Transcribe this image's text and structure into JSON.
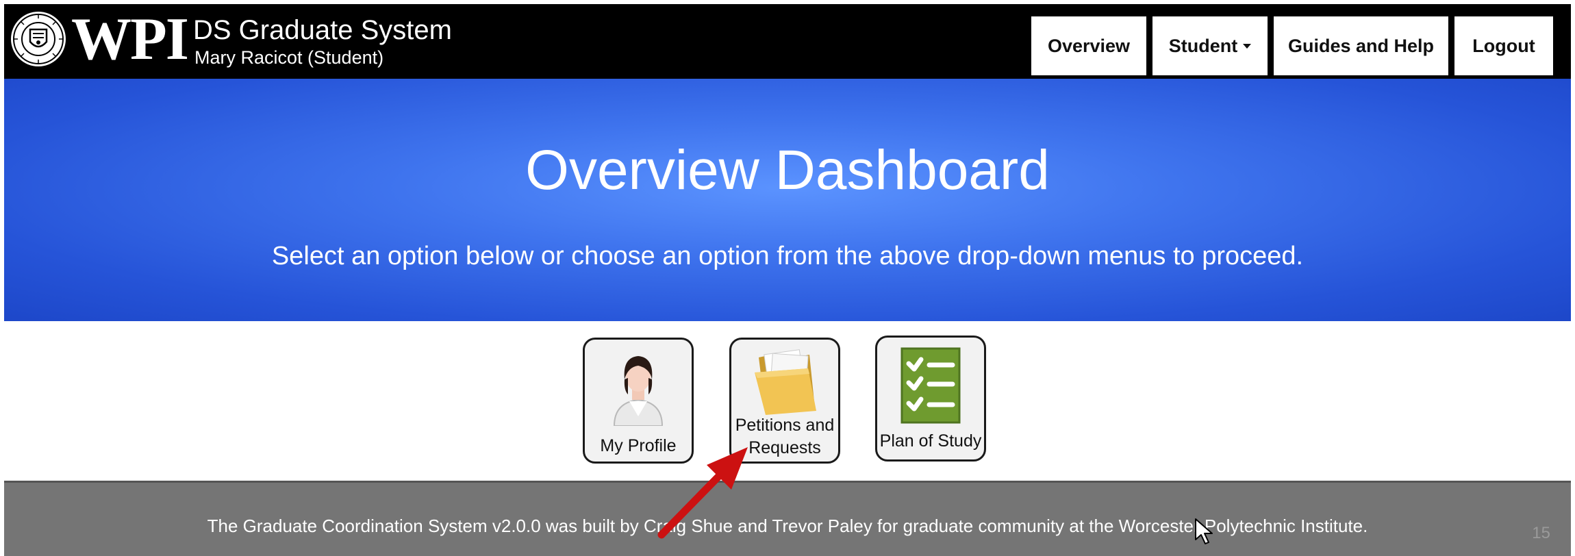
{
  "header": {
    "logo_text": "WPI",
    "system_title": "DS Graduate System",
    "user_line": "Mary Racicot (Student)",
    "nav": {
      "overview": "Overview",
      "student": "Student",
      "guides": "Guides and Help",
      "logout": "Logout"
    }
  },
  "hero": {
    "title": "Overview Dashboard",
    "subtitle": "Select an option below or choose an option from the above drop-down menus to proceed."
  },
  "tiles": [
    {
      "label": "My Profile",
      "icon": "user-avatar-icon"
    },
    {
      "label_line1": "Petitions and",
      "label_line2": "Requests",
      "icon": "folder-icon"
    },
    {
      "label": "Plan of Study",
      "icon": "checklist-icon"
    }
  ],
  "footer": {
    "text": "The Graduate Coordination System v2.0.0 was built by Craig Shue and Trevor Paley for graduate community at the Worcester Polytechnic Institute.",
    "slide_number": "15"
  },
  "colors": {
    "navbar": "#000000",
    "hero": "#2f63e0",
    "footer": "#757575",
    "annotation_arrow": "#cc1111"
  }
}
